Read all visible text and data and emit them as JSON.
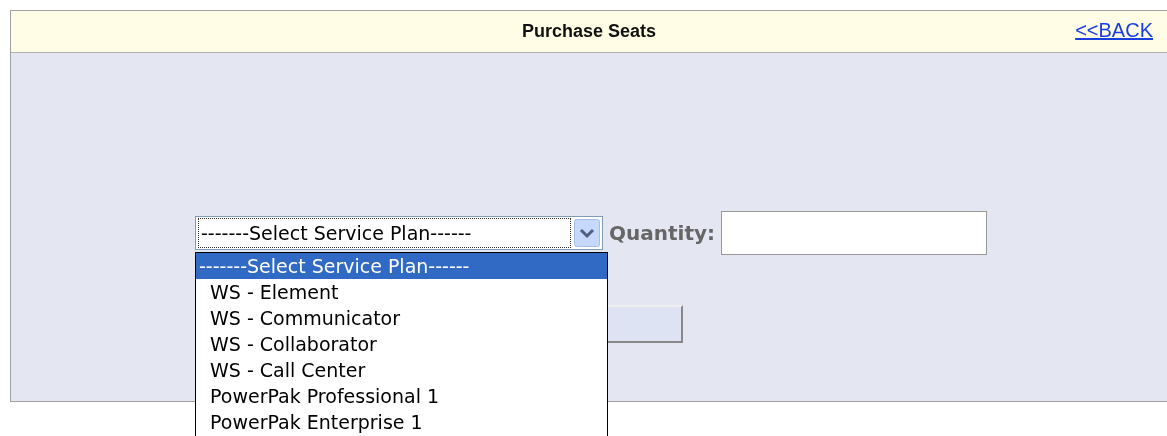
{
  "header": {
    "title": "Purchase Seats",
    "back_link": "<<BACK"
  },
  "form": {
    "service_plan": {
      "value": "-------Select Service Plan------",
      "expanded": true,
      "options": [
        {
          "label": "-------Select Service Plan------",
          "selected": true
        },
        {
          "label": "WS - Element",
          "selected": false
        },
        {
          "label": "WS - Communicator",
          "selected": false
        },
        {
          "label": "WS - Collaborator",
          "selected": false
        },
        {
          "label": "WS - Call Center",
          "selected": false
        },
        {
          "label": "PowerPak Professional 1",
          "selected": false
        },
        {
          "label": "PowerPak Enterprise 1",
          "selected": false
        }
      ]
    },
    "quantity_label": "Quantity:"
  }
}
